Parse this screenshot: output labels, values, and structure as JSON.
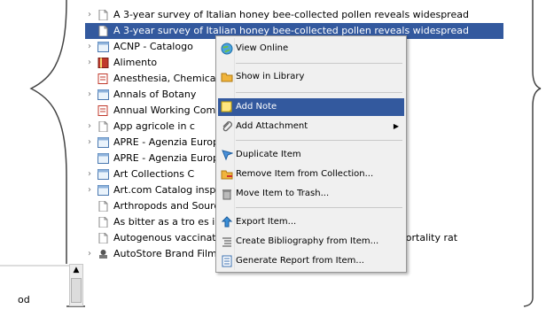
{
  "left_panel": {
    "stub_text": "od"
  },
  "items": [
    {
      "title": "A 3-year survey of Italian honey bee-collected pollen reveals widespread",
      "twisty": "›",
      "icon": "doc-icon",
      "selected": false
    },
    {
      "title": "A 3-year survey of Italian honey bee-collected pollen reveals widespread",
      "twisty": "",
      "icon": "doc-icon",
      "selected": true
    },
    {
      "title": "ACNP - Catalogo",
      "twisty": "›",
      "icon": "webpage-icon",
      "selected": false
    },
    {
      "title": "Alimento",
      "twisty": "›",
      "icon": "book-icon",
      "selected": false
    },
    {
      "title": "Anesthesia, Chemical Restraint In Snakes (Ser",
      "twisty": "",
      "icon": "report-icon",
      "selected": false
    },
    {
      "title": "Annals of Botany",
      "twisty": "›",
      "icon": "webpage-icon",
      "selected": false
    },
    {
      "title": "Annual Working Committee",
      "twisty": "",
      "icon": "report-icon",
      "selected": false
    },
    {
      "title": "App agricole in c",
      "twisty": "›",
      "icon": "doc-icon",
      "selected": false
    },
    {
      "title": "APRE - Agenzia Europea - Istituto Zo",
      "twisty": "›",
      "icon": "webpage-icon",
      "selected": false
    },
    {
      "title": "APRE - Agenzia Europea - Istituto Zo",
      "twisty": "",
      "icon": "webpage-icon",
      "selected": false
    },
    {
      "title": "Art Collections C",
      "twisty": "›",
      "icon": "webpage-icon",
      "selected": false
    },
    {
      "title": "Art.com Catalog inspiring art idea",
      "twisty": "›",
      "icon": "webpage-icon",
      "selected": false
    },
    {
      "title": "Arthropods and Sources for Shell",
      "twisty": "",
      "icon": "doc-icon",
      "selected": false
    },
    {
      "title": "As bitter as a tro es in nonsynesthe",
      "twisty": "",
      "icon": "doc-icon",
      "selected": false
    },
    {
      "title": "Autogenous vaccination reduces antimicrobial usage and mortality rat",
      "twisty": "",
      "icon": "doc-icon",
      "selected": false
    },
    {
      "title": "AutoStore Brand Film | Process in WINE after COFFEE",
      "twisty": "›",
      "icon": "video-icon",
      "selected": false
    }
  ],
  "context_menu": {
    "items": [
      {
        "label": "View Online",
        "icon": "globe-icon",
        "submenu": false,
        "active": false
      },
      {
        "label": "Show in Library",
        "icon": "folder-icon",
        "submenu": false,
        "active": false
      },
      {
        "label": "Add Note",
        "icon": "note-icon",
        "submenu": false,
        "active": true
      },
      {
        "label": "Add Attachment",
        "icon": "paperclip-icon",
        "submenu": true,
        "active": false
      },
      {
        "label": "Duplicate Item",
        "icon": "duplicate-icon",
        "submenu": false,
        "active": false
      },
      {
        "label": "Remove Item from Collection...",
        "icon": "remove-folder-icon",
        "submenu": false,
        "active": false
      },
      {
        "label": "Move Item to Trash...",
        "icon": "trash-icon",
        "submenu": false,
        "active": false
      },
      {
        "label": "Export Item...",
        "icon": "export-icon",
        "submenu": false,
        "active": false
      },
      {
        "label": "Create Bibliography from Item...",
        "icon": "bibliography-icon",
        "submenu": false,
        "active": false
      },
      {
        "label": "Generate Report from Item...",
        "icon": "report-icon",
        "submenu": false,
        "active": false
      }
    ],
    "submenu_glyph": "▶"
  },
  "colors": {
    "selection": "#33599e",
    "menu_bg": "#f0f0f0"
  }
}
